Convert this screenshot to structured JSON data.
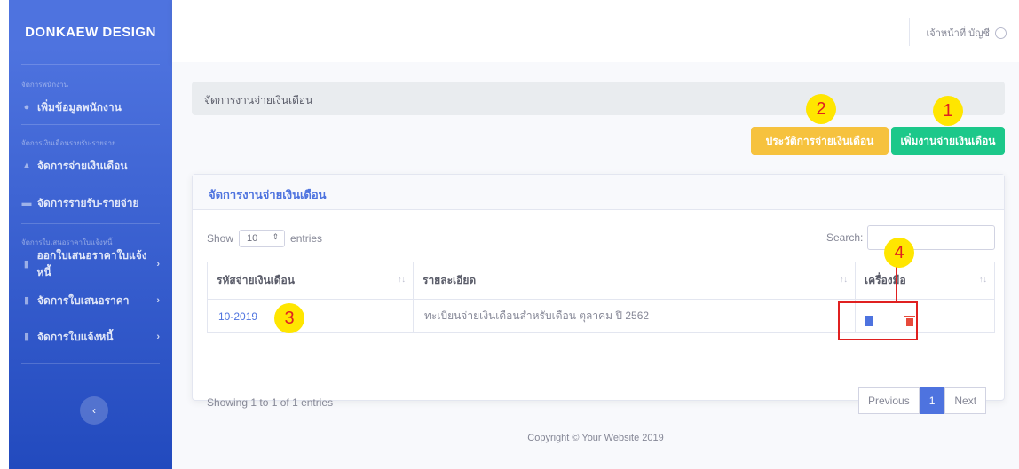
{
  "sidebar": {
    "brand": "DONKAEW DESIGN",
    "headings": [
      "จัดการพนักงาน",
      "จัดการเงินเดือนรายรับ-รายจ่าย",
      "จัดการใบเสนอราคาใบแจ้งหนี้"
    ],
    "items": [
      {
        "label": "เพิ่มข้อมูลพนักงาน",
        "icon": "users-icon"
      },
      {
        "label": "จัดการจ่ายเงินเดือน",
        "icon": "hand-money-icon"
      },
      {
        "label": "จัดการรายรับ-รายจ่าย",
        "icon": "money-bill-icon"
      },
      {
        "label": "ออกใบเสนอราคาใบแจ้งหนี้",
        "icon": "file-icon",
        "chevron": "›"
      },
      {
        "label": "จัดการใบเสนอราคา",
        "icon": "file-icon",
        "chevron": "›"
      },
      {
        "label": "จัดการใบแจ้งหนี้",
        "icon": "file-icon",
        "chevron": "›"
      }
    ],
    "toggle": "‹"
  },
  "topbar": {
    "user_label": "เจ้าหน้าที่ บัญชี",
    "user_icon": "user-circle-icon"
  },
  "breadcrumb": "จัดการงานจ่ายเงินเดือน",
  "buttons": {
    "history": "ประวัติการจ่ายเงินเดือน",
    "add": "เพิ่มงานจ่ายเงินเดือน"
  },
  "markers": [
    "1",
    "2",
    "3",
    "4"
  ],
  "card": {
    "title": "จัดการงานจ่ายเงินเดือน",
    "show_label": "Show",
    "entries_value": "10",
    "entries_label": "entries",
    "search_label": "Search:",
    "columns": [
      "รหัสจ่ายเงินเดือน",
      "รายละเอียด",
      "เครื่องมือ"
    ],
    "rows": [
      {
        "code": "10-2019",
        "detail": "ทะเบียนจ่ายเงินเดือนสำหรับเดือน ตุลาคม ปี 2562"
      }
    ],
    "summary": "Showing 1 to 1 of 1 entries",
    "pager": {
      "prev": "Previous",
      "page": "1",
      "next": "Next"
    }
  },
  "footer": "Copyright © Your Website 2019",
  "colors": {
    "primary": "#4e73df",
    "warning": "#f6c23e",
    "success": "#1cc88a",
    "danger": "#e74a3b",
    "marker": "#ffe600"
  }
}
